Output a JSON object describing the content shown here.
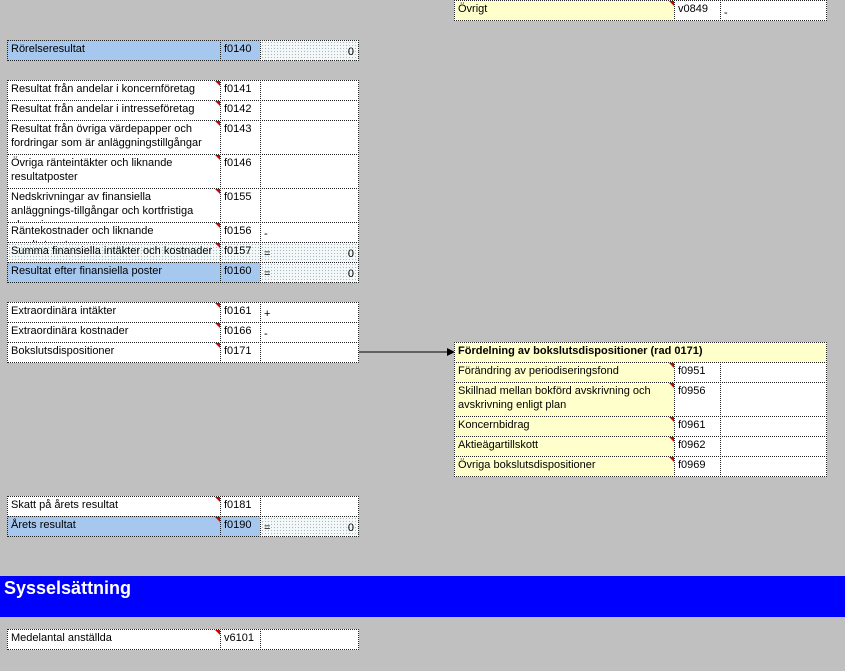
{
  "top": {
    "label": "Övrigt",
    "code": "v0849",
    "op": "-"
  },
  "operating": {
    "label": "Rörelseresultat",
    "code": "f0140",
    "value": "0"
  },
  "financial": [
    {
      "label": "Resultat från andelar i koncernföretag",
      "code": "f0141"
    },
    {
      "label": "Resultat från andelar i intresseföretag",
      "code": "f0142"
    },
    {
      "label": "Resultat från övriga värdepapper och fordringar som är anläggningstillgångar",
      "code": "f0143"
    },
    {
      "label": "Övriga ränteintäkter och liknande resultatposter",
      "code": "f0146"
    },
    {
      "label": "Nedskrivningar av finansiella anläggnings-tillgångar och kortfristiga placeringar",
      "code": "f0155"
    },
    {
      "label": "Räntekostnader och liknande resultatposter",
      "code": "f0156",
      "op": "-"
    },
    {
      "label": "Summa finansiella intäkter och kostnader",
      "code": "f0157",
      "op": "=",
      "value": "0"
    },
    {
      "label": "Resultat efter finansiella poster",
      "code": "f0160",
      "op": "=",
      "value": "0"
    }
  ],
  "extra": [
    {
      "label": "Extraordinära intäkter",
      "code": "f0161",
      "op": "+"
    },
    {
      "label": "Extraordinära kostnader",
      "code": "f0166",
      "op": "-"
    },
    {
      "label": "Bokslutsdispositioner",
      "code": "f0171"
    }
  ],
  "tax": {
    "label": "Skatt på årets resultat",
    "code": "f0181"
  },
  "year": {
    "label": "Årets resultat",
    "code": "f0190",
    "op": "=",
    "value": "0"
  },
  "dispositions": {
    "title": "Fördelning av bokslutsdispositioner (rad 0171)",
    "rows": [
      {
        "label": "Förändring av periodiseringsfond",
        "code": "f0951"
      },
      {
        "label": "Skillnad mellan bokförd avskrivning och avskrivning enligt plan",
        "code": "f0956"
      },
      {
        "label": "Koncernbidrag",
        "code": "f0961"
      },
      {
        "label": "Aktieägartillskott",
        "code": "f0962"
      },
      {
        "label": "Övriga bokslutsdispositioner",
        "code": "f0969"
      }
    ]
  },
  "employment": {
    "title": "Sysselsättning",
    "label": "Medelantal anställda",
    "code": "v6101"
  },
  "colors": {
    "band": "#0000ff",
    "highlight": "#a6c8ef",
    "note": "#ffffcc",
    "background": "#c0c0c0"
  }
}
